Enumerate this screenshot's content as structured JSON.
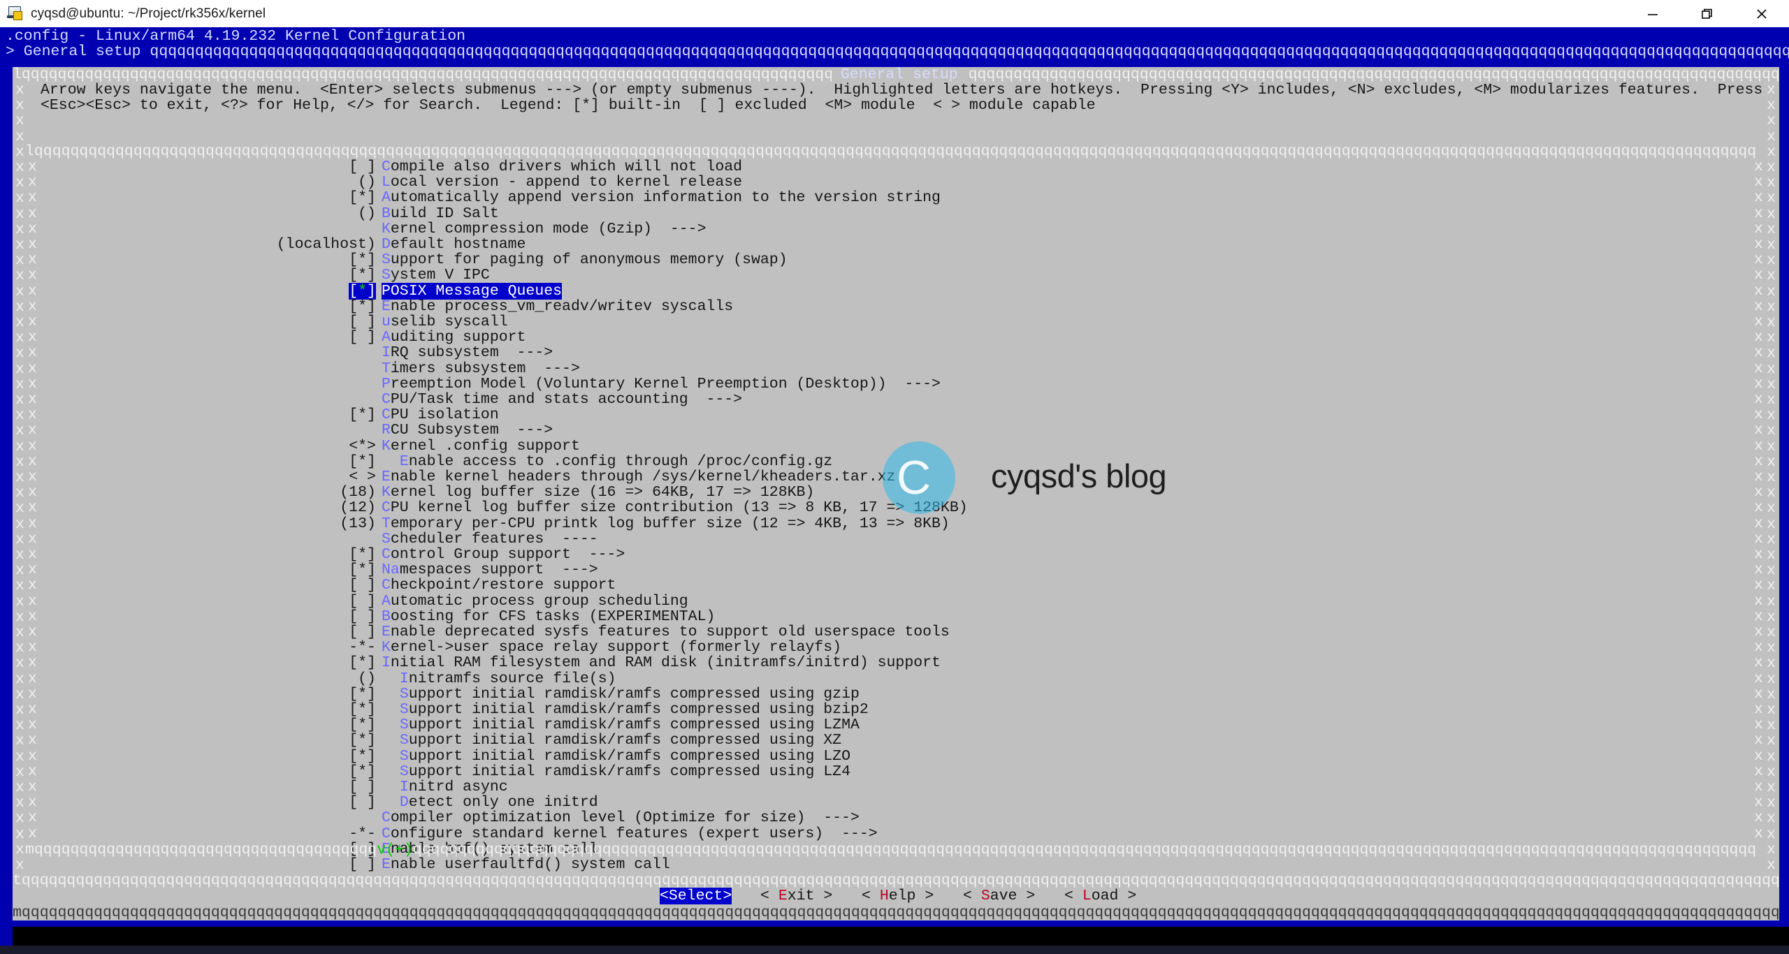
{
  "window": {
    "title": "cyqsd@ubuntu: ~/Project/rk356x/kernel",
    "icon": "terminal-icon",
    "minimize": "minimize-icon",
    "maximize": "restore-icon",
    "close": "close-icon"
  },
  "header": {
    "line1": ".config - Linux/arm64 4.19.232 Kernel Configuration",
    "breadcrumb": "> General setup ",
    "fill_char": "q"
  },
  "dialog": {
    "title": "General setup",
    "help_line1": "Arrow keys navigate the menu.  <Enter> selects submenus ---> (or empty submenus ----).  Highlighted letters are hotkeys.  Pressing <Y> includes, <N> excludes, <M> modularizes features.  Press",
    "help_line2": "<Esc><Esc> to exit, <?> for Help, </> for Search.  Legend: [*] built-in  [ ] excluded  <M> module  < > module capable",
    "scroll_indicator": "v(+)",
    "side_char": "x",
    "corner_tl": "l",
    "corner_bl": "m",
    "corner_t": "t"
  },
  "menu": [
    {
      "state": "[ ]",
      "indent": 0,
      "key": "C",
      "text": "ompile also drivers which will not load",
      "selected": false
    },
    {
      "state": "()",
      "indent": 0,
      "key": "L",
      "text": "ocal version - append to kernel release",
      "selected": false
    },
    {
      "state": "[*]",
      "indent": 0,
      "key": "A",
      "text": "utomatically append version information to the version string",
      "selected": false
    },
    {
      "state": "()",
      "indent": 0,
      "key": "B",
      "text": "uild ID Salt",
      "selected": false
    },
    {
      "state": "",
      "indent": 0,
      "key": "K",
      "text": "ernel compression mode (Gzip)  --->",
      "selected": false
    },
    {
      "state": "(localhost)",
      "indent": 0,
      "key": "D",
      "text": "efault hostname",
      "selected": false
    },
    {
      "state": "[*]",
      "indent": 0,
      "key": "S",
      "text": "upport for paging of anonymous memory (swap)",
      "selected": false
    },
    {
      "state": "[*]",
      "indent": 0,
      "key": "S",
      "text": "ystem V IPC",
      "selected": false
    },
    {
      "state": "[*]",
      "indent": 0,
      "key": "P",
      "text": "OSIX Message Queues",
      "selected": true
    },
    {
      "state": "[*]",
      "indent": 0,
      "key": "E",
      "text": "nable process_vm_readv/writev syscalls",
      "selected": false
    },
    {
      "state": "[ ]",
      "indent": 0,
      "key": "u",
      "text": "selib syscall",
      "selected": false
    },
    {
      "state": "[ ]",
      "indent": 0,
      "key": "A",
      "text": "uditing support",
      "selected": false
    },
    {
      "state": "",
      "indent": 0,
      "key": "I",
      "text": "RQ subsystem  --->",
      "selected": false
    },
    {
      "state": "",
      "indent": 0,
      "key": "T",
      "text": "imers subsystem  --->",
      "selected": false
    },
    {
      "state": "",
      "indent": 0,
      "key": "P",
      "text": "reemption Model (Voluntary Kernel Preemption (Desktop))  --->",
      "selected": false
    },
    {
      "state": "",
      "indent": 0,
      "key": "C",
      "text": "PU/Task time and stats accounting  --->",
      "selected": false
    },
    {
      "state": "[*]",
      "indent": 0,
      "key": "C",
      "text": "PU isolation",
      "selected": false
    },
    {
      "state": "",
      "indent": 0,
      "key": "R",
      "text": "CU Subsystem  --->",
      "selected": false
    },
    {
      "state": "<*>",
      "indent": 0,
      "key": "K",
      "text": "ernel .config support",
      "selected": false
    },
    {
      "state": "[*]",
      "indent": 2,
      "key": "E",
      "text": "nable access to .config through /proc/config.gz",
      "selected": false
    },
    {
      "state": "< >",
      "indent": 0,
      "key": "E",
      "text": "nable kernel headers through /sys/kernel/kheaders.tar.xz",
      "selected": false
    },
    {
      "state": "(18)",
      "indent": 0,
      "key": "K",
      "text": "ernel log buffer size (16 => 64KB, 17 => 128KB)",
      "selected": false
    },
    {
      "state": "(12)",
      "indent": 0,
      "key": "C",
      "text": "PU kernel log buffer size contribution (13 => 8 KB, 17 => 128KB)",
      "selected": false
    },
    {
      "state": "(13)",
      "indent": 0,
      "key": "T",
      "text": "emporary per-CPU printk log buffer size (12 => 4KB, 13 => 8KB)",
      "selected": false
    },
    {
      "state": "",
      "indent": 0,
      "key": "S",
      "text": "cheduler features  ----",
      "selected": false
    },
    {
      "state": "[*]",
      "indent": 0,
      "key": "C",
      "text": "ontrol Group support  --->",
      "selected": false
    },
    {
      "state": "[*]",
      "indent": 0,
      "key": "Na",
      "text": "mespaces support  --->",
      "selected": false
    },
    {
      "state": "[ ]",
      "indent": 0,
      "key": "C",
      "text": "heckpoint/restore support",
      "selected": false
    },
    {
      "state": "[ ]",
      "indent": 0,
      "key": "A",
      "text": "utomatic process group scheduling",
      "selected": false
    },
    {
      "state": "[ ]",
      "indent": 0,
      "key": "B",
      "text": "oosting for CFS tasks (EXPERIMENTAL)",
      "selected": false
    },
    {
      "state": "[ ]",
      "indent": 0,
      "key": "E",
      "text": "nable deprecated sysfs features to support old userspace tools",
      "selected": false
    },
    {
      "state": "-*-",
      "indent": 0,
      "key": "K",
      "text": "ernel->user space relay support (formerly relayfs)",
      "selected": false
    },
    {
      "state": "[*]",
      "indent": 0,
      "key": "I",
      "text": "nitial RAM filesystem and RAM disk (initramfs/initrd) support",
      "selected": false
    },
    {
      "state": "()",
      "indent": 2,
      "key": "I",
      "text": "nitramfs source file(s)",
      "selected": false
    },
    {
      "state": "[*]",
      "indent": 2,
      "key": "S",
      "text": "upport initial ramdisk/ramfs compressed using gzip",
      "selected": false
    },
    {
      "state": "[*]",
      "indent": 2,
      "key": "S",
      "text": "upport initial ramdisk/ramfs compressed using bzip2",
      "selected": false
    },
    {
      "state": "[*]",
      "indent": 2,
      "key": "S",
      "text": "upport initial ramdisk/ramfs compressed using LZMA",
      "selected": false
    },
    {
      "state": "[*]",
      "indent": 2,
      "key": "S",
      "text": "upport initial ramdisk/ramfs compressed using XZ",
      "selected": false
    },
    {
      "state": "[*]",
      "indent": 2,
      "key": "S",
      "text": "upport initial ramdisk/ramfs compressed using LZO",
      "selected": false
    },
    {
      "state": "[*]",
      "indent": 2,
      "key": "S",
      "text": "upport initial ramdisk/ramfs compressed using LZ4",
      "selected": false
    },
    {
      "state": "[ ]",
      "indent": 2,
      "key": "I",
      "text": "nitrd async",
      "selected": false
    },
    {
      "state": "[ ]",
      "indent": 2,
      "key": "D",
      "text": "etect only one initrd",
      "selected": false
    },
    {
      "state": "",
      "indent": 0,
      "key": "C",
      "text": "ompiler optimization level (Optimize for size)  --->",
      "selected": false
    },
    {
      "state": "-*-",
      "indent": 0,
      "key": "C",
      "text": "onfigure standard kernel features (expert users)  --->",
      "selected": false
    },
    {
      "state": "[ ]",
      "indent": 0,
      "key": "E",
      "text": "nable bpf() system call",
      "selected": false
    },
    {
      "state": "[ ]",
      "indent": 0,
      "key": "E",
      "text": "nable userfaultfd() system call",
      "selected": false
    }
  ],
  "buttons": [
    {
      "label": "<Select>",
      "key": "S",
      "pre": "",
      "post": "",
      "selected": true
    },
    {
      "label": "< Exit >",
      "key": "E",
      "pre": "< ",
      "post": " >",
      "selected": false
    },
    {
      "label": "< Help >",
      "key": "H",
      "pre": "< ",
      "post": " >",
      "selected": false
    },
    {
      "label": "< Save >",
      "key": "S",
      "pre": "< ",
      "post": " >",
      "selected": false
    },
    {
      "label": "< Load >",
      "key": "L",
      "pre": "< ",
      "post": " >",
      "selected": false
    }
  ],
  "watermark": {
    "logo": "c-circle-logo",
    "logo_letter": "C",
    "text": "cyqsd's blog"
  },
  "colors": {
    "terminal_bg": "#0000b0",
    "dialog_bg": "#c0c0c0",
    "selection_bg": "#0000cc",
    "hotkey": "#6a66ff",
    "button_hotkey": "#c00020",
    "checked_star": "#00e000",
    "watermark_logo": "#2fb8e8"
  }
}
